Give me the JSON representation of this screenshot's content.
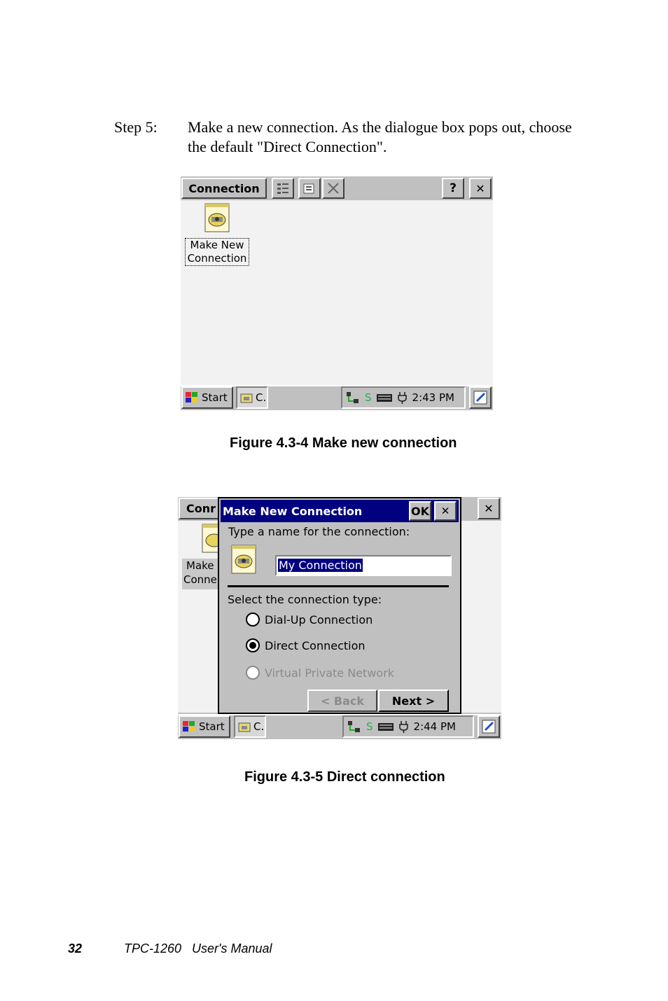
{
  "step": {
    "label": "Step 5:",
    "text": "Make a new connection. As the dialogue box pops out, choose the default \"Direct Connection\"."
  },
  "figure1": {
    "caption": "Figure 4.3-4  Make new connection",
    "window_title": "Connection",
    "toolbar_icons": [
      "details-view-icon",
      "properties-icon",
      "delete-icon"
    ],
    "help_label": "?",
    "close_label": "✕",
    "item_label_line1": "Make New",
    "item_label_line2": "Connection",
    "taskbar": {
      "start_label": "Start",
      "task_label": "C.",
      "tray_s": "S",
      "time": "2:43 PM"
    }
  },
  "figure2": {
    "caption": "Figure 4.3-5  Direct connection",
    "window_title_fragment": "Conr",
    "item_fragment_line1": "Make",
    "item_fragment_line2": "Conne",
    "dialog": {
      "title": "Make New Connection",
      "ok_label": "OK",
      "close_label": "✕",
      "prompt": "Type a name for the connection:",
      "name_value": "My Connection",
      "type_label": "Select the connection type:",
      "options": [
        {
          "label": "Dial-Up Connection",
          "selected": false,
          "enabled": true
        },
        {
          "label": "Direct Connection",
          "selected": true,
          "enabled": true
        },
        {
          "label": "Virtual Private Network",
          "selected": false,
          "enabled": false
        }
      ],
      "back_label": "< Back",
      "next_label": "Next >"
    },
    "close_label": "✕",
    "taskbar": {
      "start_label": "Start",
      "task_label": "C.",
      "tray_s": "S",
      "time": "2:44 PM"
    }
  },
  "footer": {
    "page_number": "32",
    "manual_title": "TPC-1260   User's Manual"
  },
  "colors": {
    "titlebar": "#000080",
    "face": "#c0c0c0",
    "tray_s": "#22b14c"
  }
}
